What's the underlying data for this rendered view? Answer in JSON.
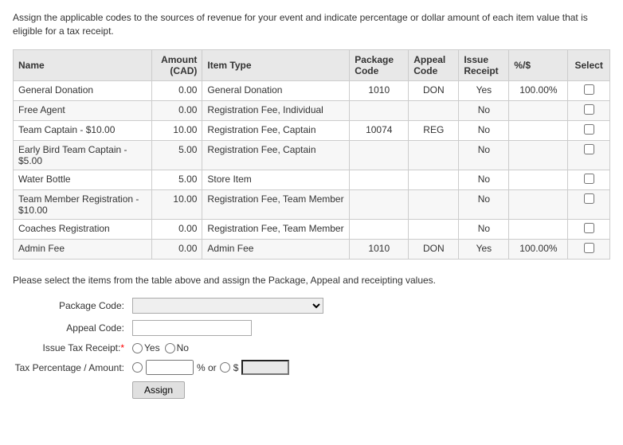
{
  "intro": {
    "text": "Assign the applicable codes to the sources of revenue for your event and indicate percentage or dollar amount of each item value that is eligible for a tax receipt."
  },
  "table": {
    "headers": [
      "Name",
      "Amount (CAD)",
      "Item Type",
      "Package Code",
      "Appeal Code",
      "Issue Receipt",
      "%/$",
      "Select"
    ],
    "rows": [
      {
        "name": "General Donation",
        "amount": "0.00",
        "itemType": "General Donation",
        "packageCode": "1010",
        "appealCode": "DON",
        "issueReceipt": "Yes",
        "pct": "100.00%",
        "select": false
      },
      {
        "name": "Free Agent",
        "amount": "0.00",
        "itemType": "Registration Fee, Individual",
        "packageCode": "",
        "appealCode": "",
        "issueReceipt": "No",
        "pct": "",
        "select": false
      },
      {
        "name": "Team Captain - $10.00",
        "amount": "10.00",
        "itemType": "Registration Fee, Captain",
        "packageCode": "10074",
        "appealCode": "REG",
        "issueReceipt": "No",
        "pct": "",
        "select": false
      },
      {
        "name": "Early Bird Team Captain - $5.00",
        "amount": "5.00",
        "itemType": "Registration Fee, Captain",
        "packageCode": "",
        "appealCode": "",
        "issueReceipt": "No",
        "pct": "",
        "select": false
      },
      {
        "name": "Water Bottle",
        "amount": "5.00",
        "itemType": "Store Item",
        "packageCode": "",
        "appealCode": "",
        "issueReceipt": "No",
        "pct": "",
        "select": false
      },
      {
        "name": "Team Member Registration - $10.00",
        "amount": "10.00",
        "itemType": "Registration Fee, Team Member",
        "packageCode": "",
        "appealCode": "",
        "issueReceipt": "No",
        "pct": "",
        "select": false
      },
      {
        "name": "Coaches Registration",
        "amount": "0.00",
        "itemType": "Registration Fee, Team Member",
        "packageCode": "",
        "appealCode": "",
        "issueReceipt": "No",
        "pct": "",
        "select": false
      },
      {
        "name": "Admin Fee",
        "amount": "0.00",
        "itemType": "Admin Fee",
        "packageCode": "1010",
        "appealCode": "DON",
        "issueReceipt": "Yes",
        "pct": "100.00%",
        "select": false
      }
    ]
  },
  "section2": {
    "text": "Please select the items from the table above and assign the Package, Appeal and receipting values."
  },
  "form": {
    "packageCodeLabel": "Package Code:",
    "appealCodeLabel": "Appeal Code:",
    "issueTaxReceiptLabel": "Issue Tax Receipt:",
    "taxPctAmountLabel": "Tax Percentage / Amount:",
    "yesLabel": "Yes",
    "noLabel": "No",
    "pctOrLabel": "% or",
    "dollarLabel": "$",
    "assignLabel": "Assign",
    "packageCodePlaceholder": "",
    "appealCodePlaceholder": "",
    "pctValue": "",
    "dollarValue": ""
  }
}
